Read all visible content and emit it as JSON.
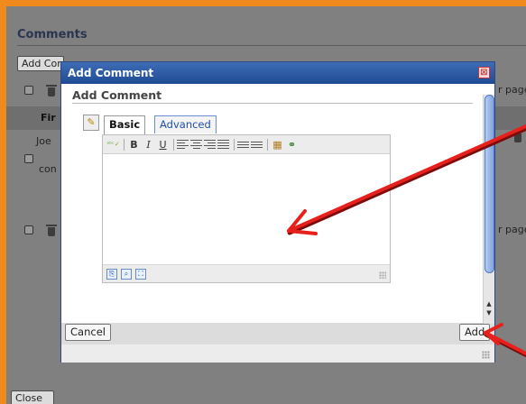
{
  "background": {
    "section_title": "Comments",
    "add_comment_button": "Add Comment",
    "per_page_text_1": "r page",
    "per_page_text_2": "r page",
    "column_header": "Fir",
    "cell_name": "Joe",
    "cell_text": "con",
    "close_button": "Close"
  },
  "dialog": {
    "title": "Add Comment",
    "close_glyph": "⊠",
    "heading": "Add Comment",
    "tabs": [
      {
        "label": "Basic",
        "active": true
      },
      {
        "label": "Advanced",
        "active": false
      }
    ],
    "toolbar_buttons": [
      "spellcheck",
      "bold",
      "italic",
      "underline",
      "align-left",
      "align-center",
      "align-right",
      "justify",
      "bullet-list",
      "numbered-list",
      "table",
      "link"
    ],
    "toolbar_glyphs": {
      "spellcheck": "ᵃᵇᶜ✓",
      "bold": "B",
      "italic": "I",
      "underline": "U",
      "table": "▦",
      "link": "⚭"
    },
    "footer_glyphs": [
      "⎘",
      "⌕",
      "⛶"
    ],
    "cancel_label": "Cancel",
    "add_label": "Add",
    "scroll_up": "▲",
    "scroll_down": "▼"
  },
  "colors": {
    "frame": "#f08a1c",
    "titlebar": "#2a5aa5",
    "arrow": "#e8201c",
    "tab_link": "#1f4fb0"
  }
}
